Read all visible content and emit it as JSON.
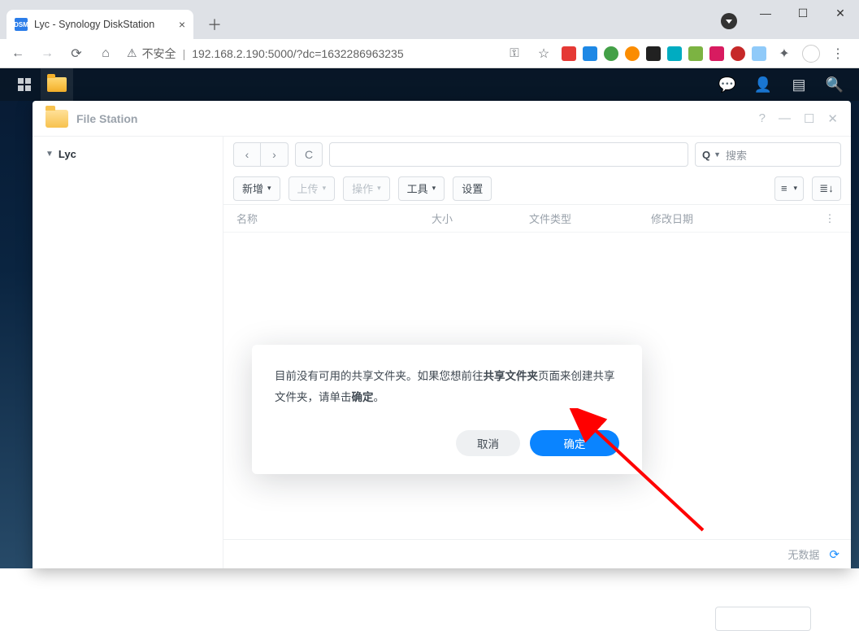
{
  "browser": {
    "tab_title": "Lyc - Synology DiskStation",
    "url_warning": "不安全",
    "url": "192.168.2.190:5000/?dc=1632286963235"
  },
  "dsm": {
    "taskbar_right": {
      "chat": "chat",
      "user": "user",
      "widgets": "widgets",
      "search": "search"
    }
  },
  "filestation": {
    "title": "File Station",
    "root_node": "Lyc",
    "search_placeholder": "搜索",
    "toolbar": {
      "new": "新增",
      "upload": "上传",
      "action": "操作",
      "tools": "工具",
      "settings": "设置"
    },
    "columns": {
      "name": "名称",
      "size": "大小",
      "type": "文件类型",
      "date": "修改日期"
    },
    "status_text": "无数据"
  },
  "modal": {
    "msg_pre": "目前没有可用的共享文件夹。如果您想前往",
    "msg_bold1": "共享文件夹",
    "msg_mid": "页面来创建共享文件夹，请单击",
    "msg_bold2": "确定",
    "msg_post": "。",
    "cancel": "取消",
    "ok": "确定"
  }
}
